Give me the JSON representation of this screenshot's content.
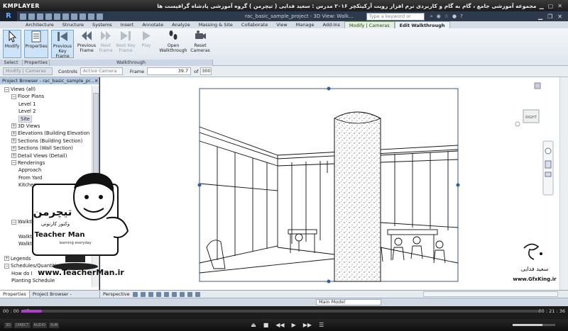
{
  "player": {
    "logo": "KMPLAYER",
    "title": "مجموعه آموزشی جامع ، گام به گام و کاربردی نرم افزار رویت آرکیتکچر ۲۰۱۶ مدرس : سعید فدایی ( تیچرمن ) گروه آموزشی پادشاه گرافیست ها",
    "current_time": "00 : 00 : 47",
    "total_time": "00 : 21 : 36",
    "progress": 0.04,
    "badges": [
      "3D",
      "DIRECT",
      "AUDIO",
      "SUB"
    ]
  },
  "app": {
    "file_name": "rac_basic_sample_project - 3D View: Walk...",
    "search_placeholder": "Type a keyword or phrase"
  },
  "tabs": [
    "Architecture",
    "Structure",
    "Systems",
    "Insert",
    "Annotate",
    "Analyze",
    "Massing & Site",
    "Collaborate",
    "View",
    "Manage",
    "Add-Ins",
    "Modify | Cameras",
    "Edit Walkthrough"
  ],
  "ribbon": {
    "modify": "Modify",
    "properties": "Properties",
    "previous_key_frame": "Previous Key Frame",
    "previous_frame": "Previous Frame",
    "next_frame": "Next Frame",
    "next_key_frame": "Next Key Frame",
    "play": "Play",
    "open_walkthrough": "Open Walkthrough",
    "reset_cameras": "Reset Cameras",
    "panels": {
      "select": "Select",
      "properties": "Properties",
      "walkthrough": "Walkthrough"
    }
  },
  "options": {
    "context": "Modify | Cameras",
    "controls_label": "Controls",
    "controls_value": "Active Camera",
    "frame_label": "Frame",
    "frame_value": "39.7",
    "of_label": "of",
    "total_frames": "300"
  },
  "browser": {
    "title": "Project Browser - rac_basic_sample_pr...",
    "items": [
      {
        "label": "Views (all)",
        "level": 0,
        "toggle": "−"
      },
      {
        "label": "Floor Plans",
        "level": 1,
        "toggle": "−"
      },
      {
        "label": "Level 1",
        "level": 2,
        "toggle": ""
      },
      {
        "label": "Level 2",
        "level": 2,
        "toggle": ""
      },
      {
        "label": "Site",
        "level": 2,
        "toggle": "",
        "selected": true
      },
      {
        "label": "3D Views",
        "level": 1,
        "toggle": "+"
      },
      {
        "label": "Elevations (Building Elevation",
        "level": 1,
        "toggle": "+"
      },
      {
        "label": "Sections (Building Section)",
        "level": 1,
        "toggle": "+"
      },
      {
        "label": "Sections (Wall Section)",
        "level": 1,
        "toggle": "+"
      },
      {
        "label": "Detail Views (Detail)",
        "level": 1,
        "toggle": "+"
      },
      {
        "label": "Renderings",
        "level": 1,
        "toggle": "−"
      },
      {
        "label": "Approach",
        "level": 2,
        "toggle": ""
      },
      {
        "label": "From Yard",
        "level": 2,
        "toggle": ""
      },
      {
        "label": "Kitchen",
        "level": 2,
        "toggle": ""
      },
      {
        "label": "",
        "level": 2,
        "toggle": ""
      },
      {
        "label": "",
        "level": 2,
        "toggle": ""
      },
      {
        "label": "",
        "level": 2,
        "toggle": ""
      },
      {
        "label": "",
        "level": 2,
        "toggle": ""
      },
      {
        "label": "Walkthroughs",
        "level": 1,
        "toggle": "−"
      },
      {
        "label": "",
        "level": 2,
        "toggle": ""
      },
      {
        "label": "Walkthrough 1",
        "level": 2,
        "toggle": ""
      },
      {
        "label": "Walkthrough 2",
        "level": 2,
        "toggle": ""
      },
      {
        "label": "",
        "level": 0,
        "toggle": ""
      },
      {
        "label": "Legends",
        "level": 0,
        "toggle": "+"
      },
      {
        "label": "Schedules/Quantities",
        "level": 0,
        "toggle": "−"
      },
      {
        "label": "How do I",
        "level": 1,
        "toggle": ""
      },
      {
        "label": "Planting Schedule",
        "level": 1,
        "toggle": ""
      }
    ]
  },
  "bottom_tabs": [
    "Properties",
    "Project Browser - rac_basic_..."
  ],
  "view": {
    "style": "Perspective",
    "viewcube_label": "RIGHT",
    "main_model": "Main Model"
  },
  "branding": {
    "logo_fa": "تیچرمن",
    "tagline_fa": "وکتور کارتونی",
    "name": "Teacher Man",
    "sub": "learning everyday",
    "url": "www.TeacherMan.ir",
    "right_fa": "سعید فدایی",
    "right_url": "www.GfxKing.ir"
  },
  "colors": {
    "accent": "#b040c8",
    "ribbon_bg": "#e8eef5",
    "title_bar": "#2c3a4c"
  }
}
